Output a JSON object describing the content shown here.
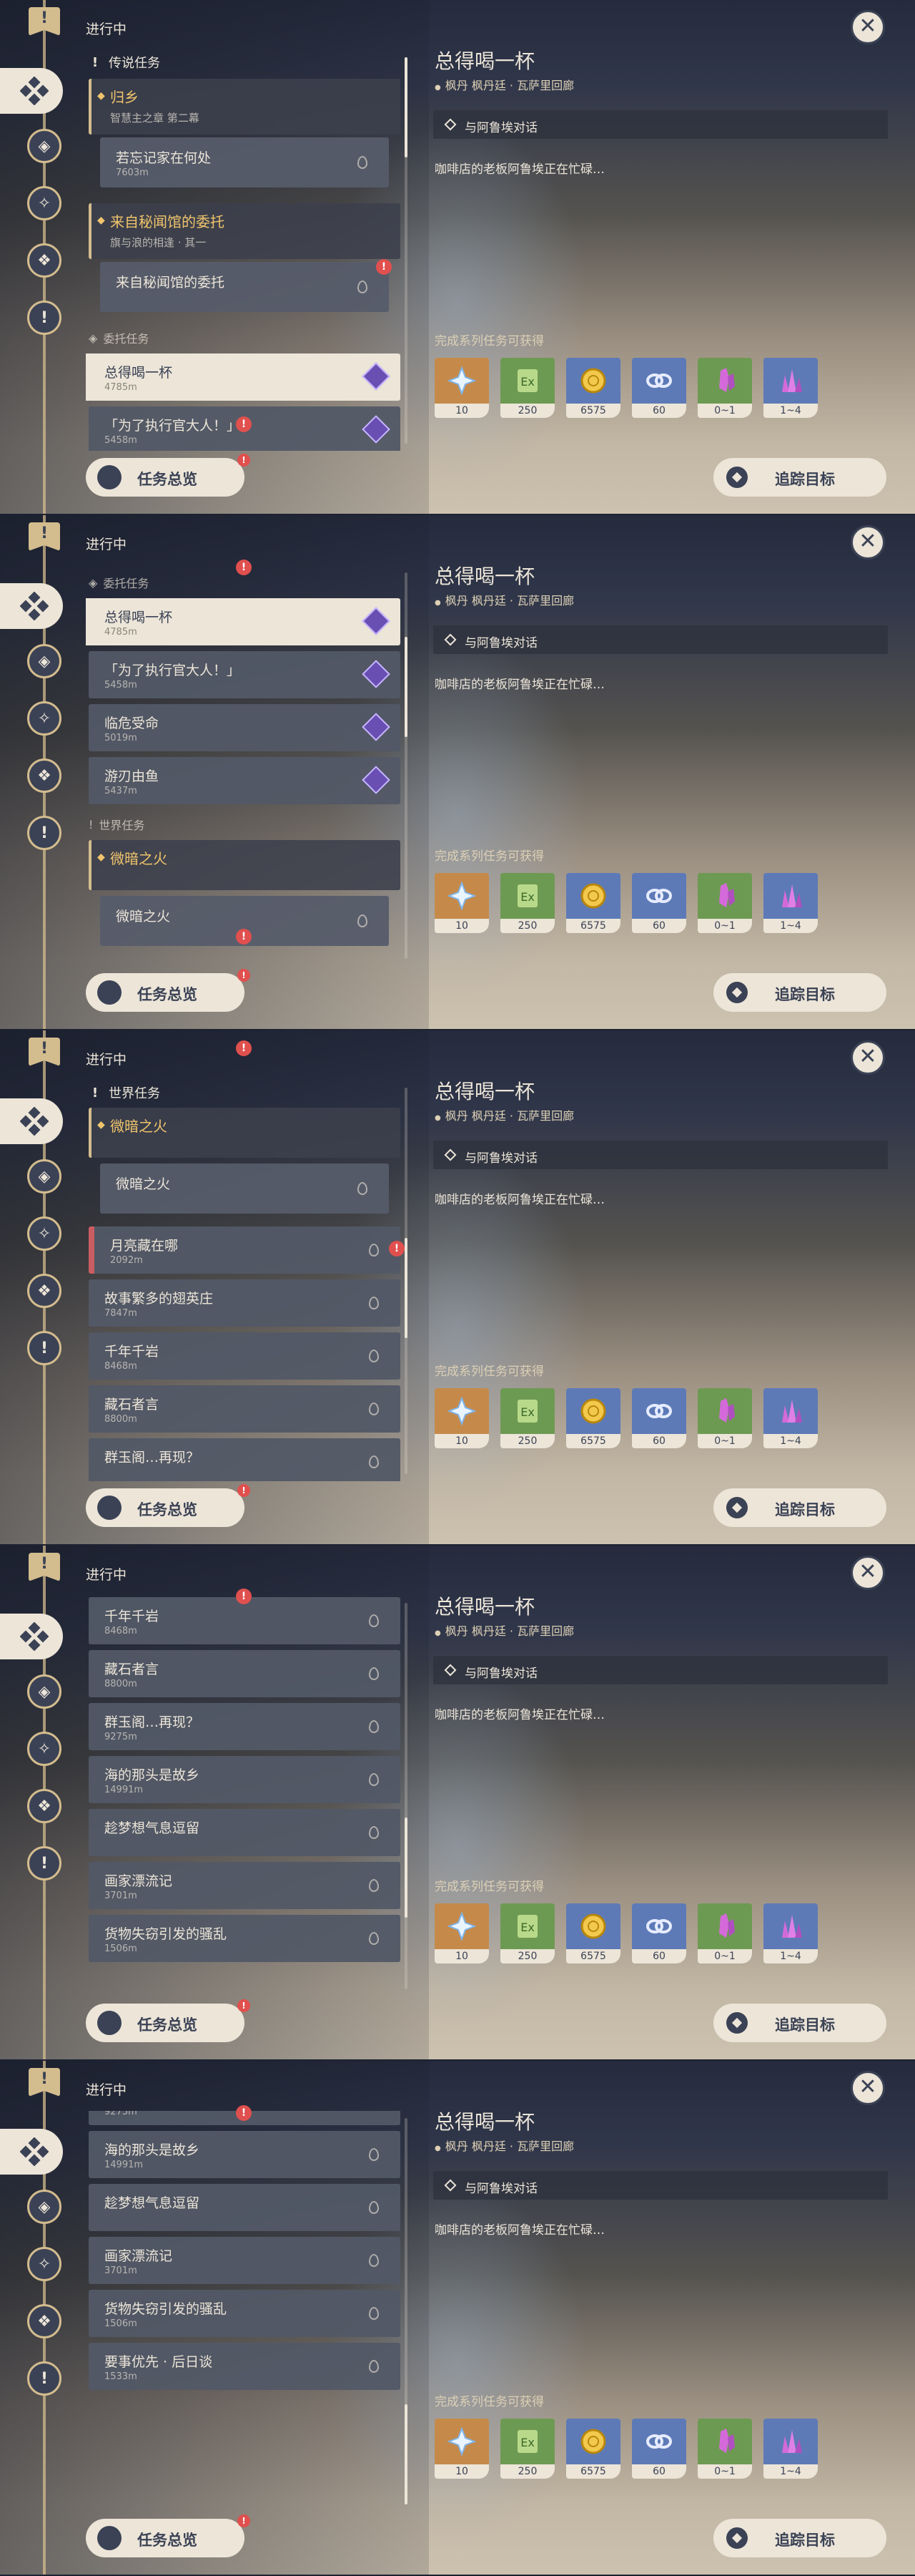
{
  "ui": {
    "section_title": "进行中",
    "overview_label": "任务总览",
    "track_label": "追踪目标",
    "close_glyph": "✕",
    "badge": "!"
  },
  "detail": {
    "title": "总得喝一杯",
    "location": "枫丹 枫丹廷 · 瓦萨里回廊",
    "objective": "与阿鲁埃对话",
    "description": "咖啡店的老板阿鲁埃正在忙碌…",
    "rewards_title": "完成系列任务可获得",
    "rewards": [
      {
        "name": "primogem-icon",
        "qty": "10",
        "color": "#c58a4a"
      },
      {
        "name": "adventure-exp-icon",
        "qty": "250",
        "color": "#6d9a52"
      },
      {
        "name": "mora-icon",
        "qty": "6575",
        "color": "#5d7ab7"
      },
      {
        "name": "companionship-exp-icon",
        "qty": "60",
        "color": "#5d7ab7"
      },
      {
        "name": "crystal-icon",
        "qty": "0~1",
        "color": "#6d9a52"
      },
      {
        "name": "crystal-cluster-icon",
        "qty": "1~4",
        "color": "#5d7ab7"
      }
    ]
  },
  "quests": {
    "legend_header": "传说任务",
    "legend_group_title": "归乡",
    "legend_group_sub": "智慧主之章 第二幕",
    "legend_step": "若忘记家在何处",
    "legend_step_dist": "7603m",
    "archive_group_title": "来自秘闻馆的委托",
    "archive_group_sub": "旗与浪的相逢 · 其一",
    "archive_step": "来自秘闻馆的委托",
    "commission_header": "委托任务",
    "world_header": "世界任务",
    "world_group_title": "微暗之火",
    "world_step": "微暗之火",
    "c1": {
      "t": "总得喝一杯",
      "m": "4785m"
    },
    "c2": {
      "t": "「为了执行官大人！」",
      "m": "5458m"
    },
    "c3": {
      "t": "临危受命",
      "m": "5019m"
    },
    "c4": {
      "t": "游刃由鱼",
      "m": "5437m"
    },
    "w1": {
      "t": "月亮藏在哪",
      "m": "2092m"
    },
    "w2": {
      "t": "故事繁多的翅英庄",
      "m": "7847m"
    },
    "w3": {
      "t": "千年千岩",
      "m": "8468m"
    },
    "w4": {
      "t": "藏石者言",
      "m": "8800m"
    },
    "w5": {
      "t": "群玉阁…再现？",
      "m": "9275m"
    },
    "w6": {
      "t": "海的那头是故乡",
      "m": "14991m"
    },
    "w7": {
      "t": "趁梦想气息逗留",
      "m": ""
    },
    "w8": {
      "t": "画家漂流记",
      "m": "3701m"
    },
    "w9": {
      "t": "货物失窃引发的骚乱",
      "m": "1506m"
    },
    "w10": {
      "t": "要事优先 · 后日谈",
      "m": "1533m"
    }
  }
}
